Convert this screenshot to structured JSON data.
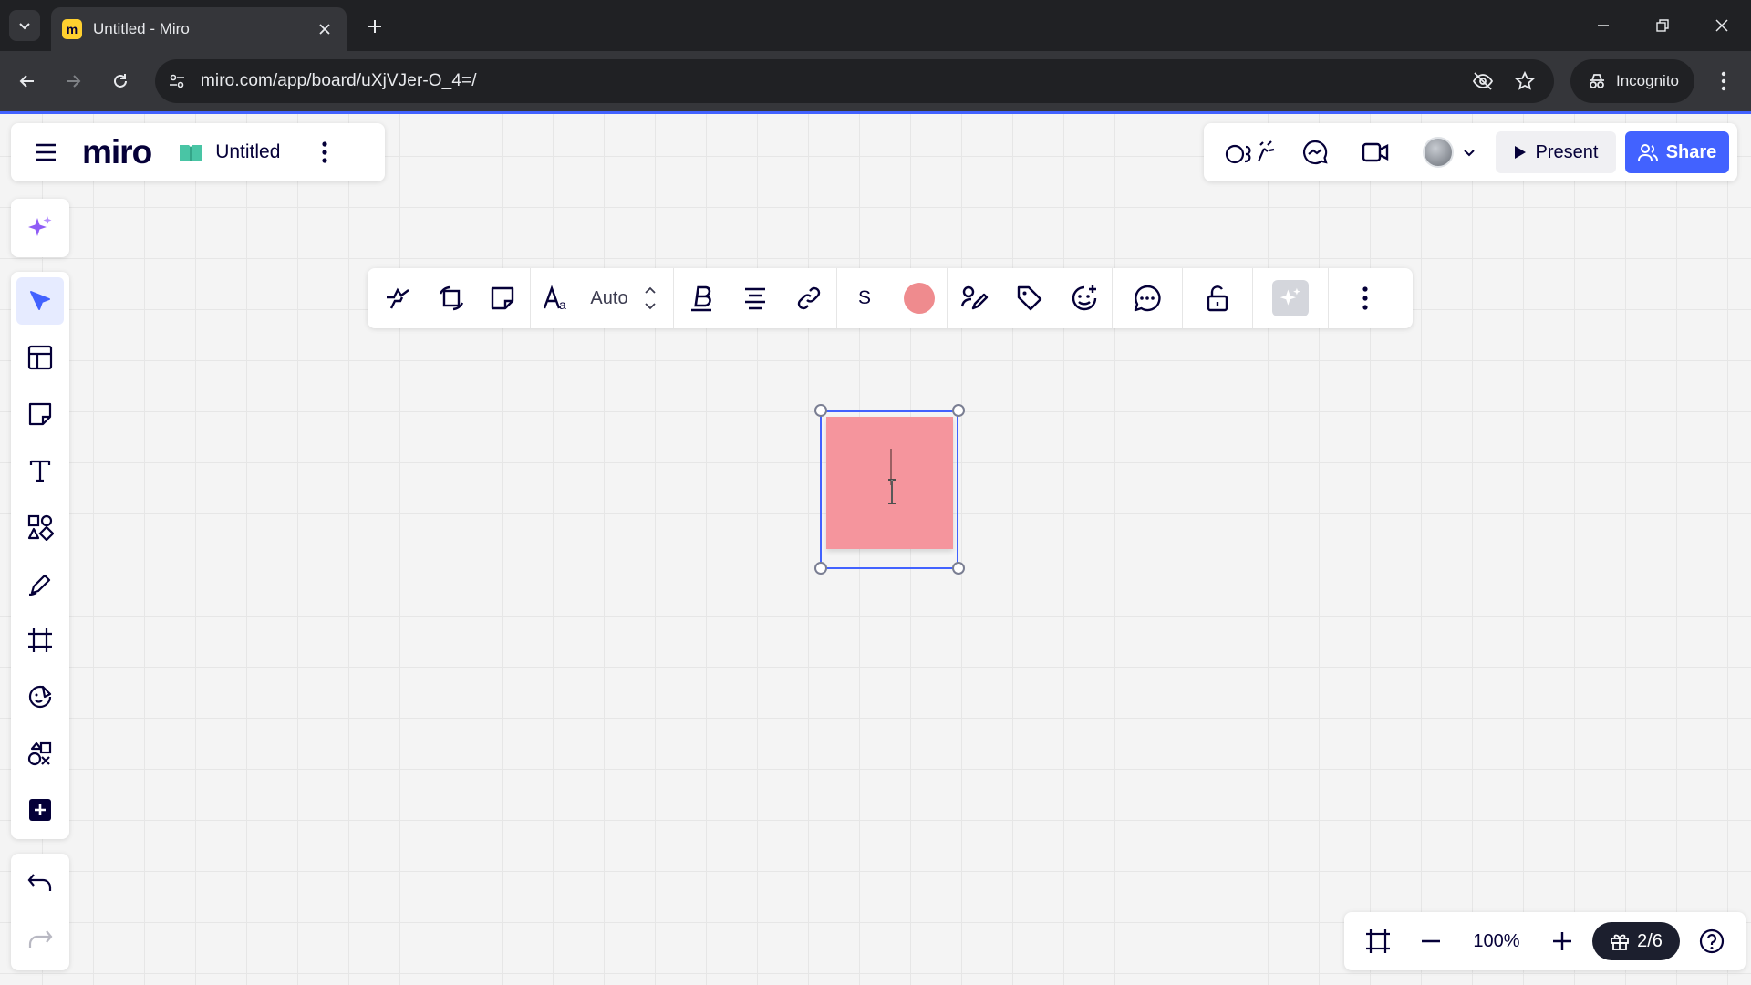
{
  "browser": {
    "tab_title": "Untitled - Miro",
    "url": "miro.com/app/board/uXjVJer-O_4=/",
    "incognito_label": "Incognito"
  },
  "app": {
    "logo": "miro",
    "board_title": "Untitled"
  },
  "header_actions": {
    "present_label": "Present",
    "share_label": "Share"
  },
  "context_toolbar": {
    "font_size": "Auto",
    "text_style_letter": "S",
    "sticky_color": "#ef8b8e"
  },
  "left_toolbar": {
    "tools": [
      "select",
      "templates",
      "sticky-note",
      "text",
      "shapes",
      "pen",
      "frame",
      "stickers",
      "diagramming",
      "more-apps"
    ]
  },
  "zoom": {
    "level": "100%",
    "whats_new_count": "2/6"
  },
  "colors": {
    "accent": "#4262ff",
    "sticky": "#f5959d",
    "ai": "#8f5cf6"
  }
}
